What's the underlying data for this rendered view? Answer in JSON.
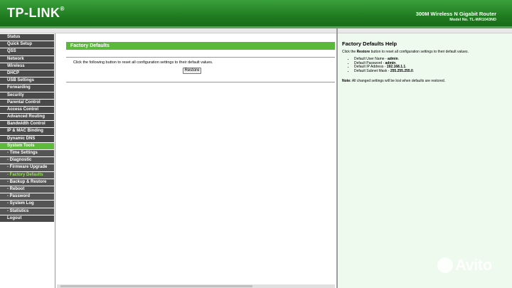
{
  "header": {
    "logo": "TP-LINK",
    "logo_mark": "®",
    "product": "300M Wireless N Gigabit Router",
    "model": "Model No. TL-WR1043ND"
  },
  "sidebar": {
    "items": [
      {
        "label": "Status"
      },
      {
        "label": "Quick Setup"
      },
      {
        "label": "QSS"
      },
      {
        "label": "Network"
      },
      {
        "label": "Wireless"
      },
      {
        "label": "DHCP"
      },
      {
        "label": "USB Settings"
      },
      {
        "label": "Forwarding"
      },
      {
        "label": "Security"
      },
      {
        "label": "Parental Control"
      },
      {
        "label": "Access Control"
      },
      {
        "label": "Advanced Routing"
      },
      {
        "label": "Bandwidth Control"
      },
      {
        "label": "IP & MAC Binding"
      },
      {
        "label": "Dynamic DNS"
      },
      {
        "label": "System Tools"
      },
      {
        "label": "- Time Settings"
      },
      {
        "label": "- Diagnostic"
      },
      {
        "label": "- Firmware Upgrade"
      },
      {
        "label": "- Factory Defaults"
      },
      {
        "label": "- Backup & Restore"
      },
      {
        "label": "- Reboot"
      },
      {
        "label": "- Password"
      },
      {
        "label": "- System Log"
      },
      {
        "label": "- Statistics"
      },
      {
        "label": "Logout"
      }
    ]
  },
  "main": {
    "title": "Factory Defaults",
    "description": "Click the following button to reset all configuration settings to their default values.",
    "restore_label": "Restore"
  },
  "help": {
    "title": "Factory Defaults Help",
    "intro_pre": "Click the ",
    "intro_bold": "Restore",
    "intro_post": " button to reset all configuration settings to their default values.",
    "items": [
      {
        "label": "Default User Name - ",
        "value": "admin",
        "end": "."
      },
      {
        "label": "Default Password - ",
        "value": "admin",
        "end": "."
      },
      {
        "label": "Default IP Address - ",
        "value": "192.168.1.1",
        "end": "."
      },
      {
        "label": "Default Subnet Mask - ",
        "value": "255.255.255.0",
        "end": "."
      }
    ],
    "note_label": "Note:",
    "note_text": " All changed settings will be lost when defaults are restored."
  },
  "watermark": "Avito",
  "colors": {
    "brand_green": "#2f8f2f",
    "title_bar": "#5ab83a",
    "menu_bg": "#4a4a4a",
    "menu_active": "#5dba3a",
    "help_bg": "#eefaee"
  }
}
